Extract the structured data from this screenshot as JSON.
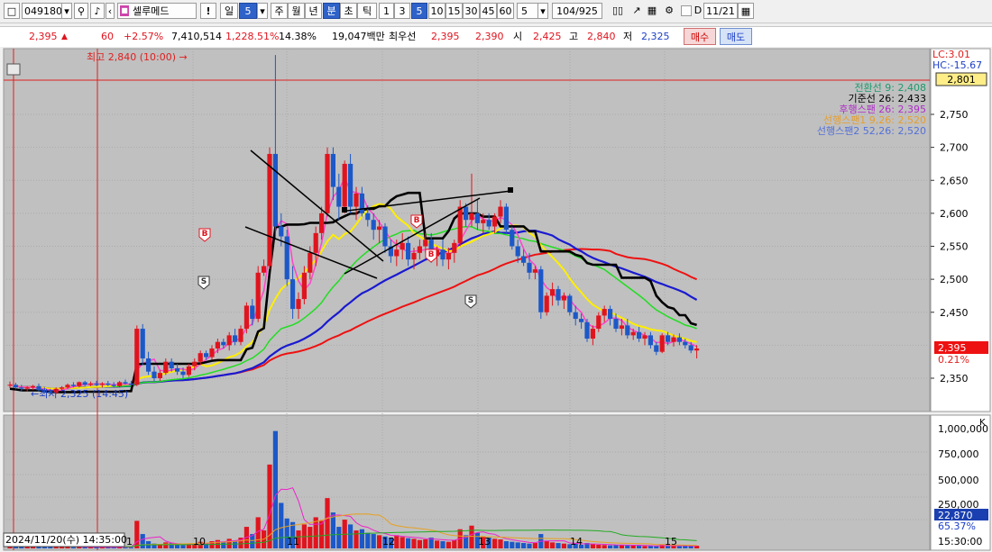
{
  "toolbar": {
    "code": "049180",
    "name": "셀루메드",
    "period_day": "일",
    "period_value": "5",
    "periods": [
      "주",
      "월",
      "년",
      "분",
      "초",
      "틱"
    ],
    "intervals": [
      "1",
      "3",
      "5",
      "10",
      "15",
      "30",
      "45",
      "60"
    ],
    "count_select": "5",
    "range": "104/925",
    "date_label": "D",
    "date_value": "11/21"
  },
  "quote": {
    "price": "2,395",
    "arrow": "▲",
    "change": "60",
    "change_pct": "+2.57%",
    "volume": "7,410,514",
    "volume_ratio": "1,228.51%",
    "turnover_pct": "14.38%",
    "amount": "19,047백만",
    "best_ask_label": "최우선",
    "best_ask": "2,395",
    "best_bid": "2,390",
    "open_label": "시",
    "open": "2,425",
    "high_label": "고",
    "high": "2,840",
    "low_label": "저",
    "low": "2,325",
    "buy_label": "매수",
    "sell_label": "매도"
  },
  "chart": {
    "lc_label": "LC:3.01",
    "hc_label": "HC:-15.67",
    "price_tag_top": "2,801",
    "high_marker": "최고 2,840 (10:00) →",
    "low_marker": "←최저 2,325 (14:45)",
    "cursor_time": "2024/11/20(수) 14:35:00",
    "right_time": "15:30:00",
    "current_price_tag": "2,395",
    "current_pct_tag": "0.21%",
    "volume_tag": "22,870",
    "volume_pct_tag": "65.37%",
    "volume_unit": "K",
    "legend": [
      {
        "label": "전환선 9: 2,408",
        "color": "#1d9a6c"
      },
      {
        "label": "기준선 26: 2,433",
        "color": "#000000"
      },
      {
        "label": "후행스팬 26: 2,395",
        "color": "#b02cc9"
      },
      {
        "label": "선행스팬1 9,26: 2,520",
        "color": "#e69e2c"
      },
      {
        "label": "선행스팬2 52,26: 2,520",
        "color": "#5470d8"
      }
    ],
    "price_ticks": [
      "2,750",
      "2,700",
      "2,650",
      "2,600",
      "2,550",
      "2,500",
      "2,450",
      "2,350"
    ],
    "volume_ticks": [
      "1,000,000",
      "750,000",
      "500,000",
      "250,000"
    ],
    "day_labels": [
      "10",
      "11",
      "12",
      "13",
      "14",
      "15"
    ],
    "first_bar_label": "1",
    "signals": [
      "B",
      "B",
      "B",
      "S",
      "S"
    ],
    "colors": {
      "up": "#e0141e",
      "down": "#1c58c8",
      "ma_yellow": "#ffee00",
      "ma_green": "#22dd22",
      "ma_blue": "#1a1ad0",
      "ma_red": "#ee1111",
      "baseline": "#000000",
      "tenkan": "#ff44cc"
    }
  },
  "chart_data": {
    "type": "candlestick",
    "interval": "5분",
    "price_range": [
      2325,
      2840
    ],
    "ylim": [
      2300,
      2800
    ],
    "candles_ohlc": [
      [
        2340,
        2345,
        2335,
        2340
      ],
      [
        2340,
        2343,
        2333,
        2336
      ],
      [
        2336,
        2340,
        2330,
        2334
      ],
      [
        2334,
        2338,
        2330,
        2336
      ],
      [
        2336,
        2340,
        2332,
        2338
      ],
      [
        2338,
        2342,
        2330,
        2332
      ],
      [
        2332,
        2336,
        2328,
        2330
      ],
      [
        2330,
        2334,
        2325,
        2328
      ],
      [
        2328,
        2336,
        2326,
        2334
      ],
      [
        2334,
        2338,
        2330,
        2336
      ],
      [
        2336,
        2342,
        2334,
        2340
      ],
      [
        2340,
        2344,
        2336,
        2338
      ],
      [
        2338,
        2345,
        2336,
        2344
      ],
      [
        2344,
        2346,
        2338,
        2340
      ],
      [
        2340,
        2345,
        2338,
        2342
      ],
      [
        2342,
        2346,
        2338,
        2340
      ],
      [
        2340,
        2344,
        2336,
        2342
      ],
      [
        2342,
        2346,
        2338,
        2340
      ],
      [
        2340,
        2344,
        2336,
        2338
      ],
      [
        2338,
        2346,
        2336,
        2344
      ],
      [
        2344,
        2348,
        2340,
        2342
      ],
      [
        2342,
        2346,
        2338,
        2340
      ],
      [
        2340,
        2430,
        2338,
        2425
      ],
      [
        2425,
        2432,
        2370,
        2380
      ],
      [
        2380,
        2390,
        2355,
        2360
      ],
      [
        2360,
        2368,
        2345,
        2350
      ],
      [
        2350,
        2362,
        2346,
        2358
      ],
      [
        2358,
        2380,
        2355,
        2375
      ],
      [
        2375,
        2380,
        2360,
        2365
      ],
      [
        2365,
        2372,
        2355,
        2360
      ],
      [
        2360,
        2366,
        2350,
        2355
      ],
      [
        2355,
        2372,
        2352,
        2368
      ],
      [
        2368,
        2380,
        2362,
        2375
      ],
      [
        2375,
        2392,
        2370,
        2388
      ],
      [
        2388,
        2392,
        2378,
        2382
      ],
      [
        2382,
        2400,
        2378,
        2395
      ],
      [
        2395,
        2410,
        2388,
        2405
      ],
      [
        2405,
        2410,
        2395,
        2400
      ],
      [
        2400,
        2420,
        2392,
        2415
      ],
      [
        2415,
        2425,
        2400,
        2405
      ],
      [
        2405,
        2430,
        2400,
        2425
      ],
      [
        2425,
        2465,
        2418,
        2460
      ],
      [
        2460,
        2470,
        2430,
        2440
      ],
      [
        2440,
        2520,
        2435,
        2510
      ],
      [
        2510,
        2530,
        2505,
        2520
      ],
      [
        2520,
        2700,
        2515,
        2690
      ],
      [
        2690,
        2840,
        2560,
        2580
      ],
      [
        2580,
        2600,
        2550,
        2565
      ],
      [
        2565,
        2575,
        2490,
        2500
      ],
      [
        2500,
        2520,
        2440,
        2455
      ],
      [
        2455,
        2480,
        2440,
        2470
      ],
      [
        2470,
        2520,
        2462,
        2510
      ],
      [
        2510,
        2550,
        2500,
        2540
      ],
      [
        2540,
        2580,
        2520,
        2570
      ],
      [
        2570,
        2610,
        2560,
        2600
      ],
      [
        2600,
        2700,
        2595,
        2690
      ],
      [
        2690,
        2700,
        2620,
        2640
      ],
      [
        2640,
        2660,
        2590,
        2610
      ],
      [
        2610,
        2680,
        2600,
        2675
      ],
      [
        2675,
        2690,
        2600,
        2610
      ],
      [
        2610,
        2640,
        2590,
        2630
      ],
      [
        2630,
        2640,
        2595,
        2600
      ],
      [
        2600,
        2612,
        2580,
        2590
      ],
      [
        2590,
        2600,
        2560,
        2575
      ],
      [
        2575,
        2590,
        2555,
        2580
      ],
      [
        2580,
        2585,
        2540,
        2550
      ],
      [
        2550,
        2560,
        2525,
        2535
      ],
      [
        2535,
        2560,
        2520,
        2545
      ],
      [
        2545,
        2570,
        2530,
        2555
      ],
      [
        2555,
        2565,
        2520,
        2530
      ],
      [
        2530,
        2548,
        2515,
        2540
      ],
      [
        2540,
        2560,
        2530,
        2550
      ],
      [
        2550,
        2570,
        2540,
        2560
      ],
      [
        2560,
        2570,
        2525,
        2535
      ],
      [
        2535,
        2550,
        2520,
        2545
      ],
      [
        2545,
        2560,
        2520,
        2530
      ],
      [
        2530,
        2548,
        2515,
        2540
      ],
      [
        2540,
        2560,
        2525,
        2555
      ],
      [
        2555,
        2620,
        2550,
        2610
      ],
      [
        2610,
        2615,
        2580,
        2590
      ],
      [
        2590,
        2660,
        2580,
        2600
      ],
      [
        2600,
        2620,
        2575,
        2585
      ],
      [
        2585,
        2600,
        2570,
        2590
      ],
      [
        2590,
        2600,
        2575,
        2580
      ],
      [
        2580,
        2600,
        2570,
        2595
      ],
      [
        2595,
        2620,
        2585,
        2610
      ],
      [
        2610,
        2615,
        2570,
        2575
      ],
      [
        2575,
        2580,
        2545,
        2550
      ],
      [
        2550,
        2560,
        2525,
        2535
      ],
      [
        2535,
        2545,
        2520,
        2525
      ],
      [
        2525,
        2540,
        2500,
        2510
      ],
      [
        2510,
        2520,
        2500,
        2515
      ],
      [
        2515,
        2520,
        2440,
        2450
      ],
      [
        2450,
        2480,
        2445,
        2475
      ],
      [
        2475,
        2495,
        2460,
        2485
      ],
      [
        2485,
        2490,
        2460,
        2468
      ],
      [
        2468,
        2480,
        2455,
        2475
      ],
      [
        2475,
        2478,
        2445,
        2450
      ],
      [
        2450,
        2460,
        2430,
        2440
      ],
      [
        2440,
        2448,
        2425,
        2435
      ],
      [
        2435,
        2440,
        2405,
        2410
      ],
      [
        2410,
        2430,
        2400,
        2425
      ],
      [
        2425,
        2450,
        2420,
        2445
      ],
      [
        2445,
        2460,
        2435,
        2455
      ],
      [
        2455,
        2460,
        2430,
        2440
      ],
      [
        2440,
        2448,
        2420,
        2425
      ],
      [
        2425,
        2440,
        2415,
        2430
      ],
      [
        2430,
        2440,
        2410,
        2415
      ],
      [
        2415,
        2425,
        2408,
        2420
      ],
      [
        2420,
        2428,
        2405,
        2410
      ],
      [
        2410,
        2420,
        2400,
        2415
      ],
      [
        2415,
        2420,
        2395,
        2400
      ],
      [
        2400,
        2405,
        2385,
        2390
      ],
      [
        2390,
        2418,
        2388,
        2415
      ],
      [
        2415,
        2420,
        2400,
        2405
      ],
      [
        2405,
        2416,
        2398,
        2412
      ],
      [
        2412,
        2418,
        2400,
        2405
      ],
      [
        2405,
        2410,
        2395,
        2400
      ],
      [
        2400,
        2405,
        2388,
        2392
      ],
      [
        2392,
        2400,
        2380,
        2395
      ]
    ],
    "volumes_k": [
      20,
      15,
      18,
      12,
      16,
      22,
      25,
      30,
      18,
      14,
      12,
      10,
      14,
      12,
      10,
      9,
      8,
      10,
      12,
      14,
      12,
      10,
      230,
      120,
      60,
      40,
      35,
      50,
      45,
      30,
      28,
      35,
      40,
      55,
      45,
      60,
      70,
      50,
      80,
      65,
      90,
      180,
      120,
      260,
      150,
      700,
      980,
      380,
      250,
      220,
      150,
      200,
      180,
      260,
      230,
      420,
      300,
      180,
      240,
      200,
      150,
      160,
      130,
      120,
      110,
      100,
      90,
      110,
      95,
      85,
      80,
      70,
      75,
      90,
      65,
      60,
      55,
      70,
      160,
      110,
      190,
      130,
      100,
      90,
      80,
      75,
      60,
      55,
      50,
      45,
      40,
      45,
      120,
      60,
      50,
      45,
      40,
      35,
      40,
      30,
      45,
      35,
      30,
      28,
      25,
      30,
      28,
      26,
      24,
      22,
      20,
      22,
      18,
      35,
      20,
      22,
      18,
      20,
      24,
      22
    ]
  }
}
